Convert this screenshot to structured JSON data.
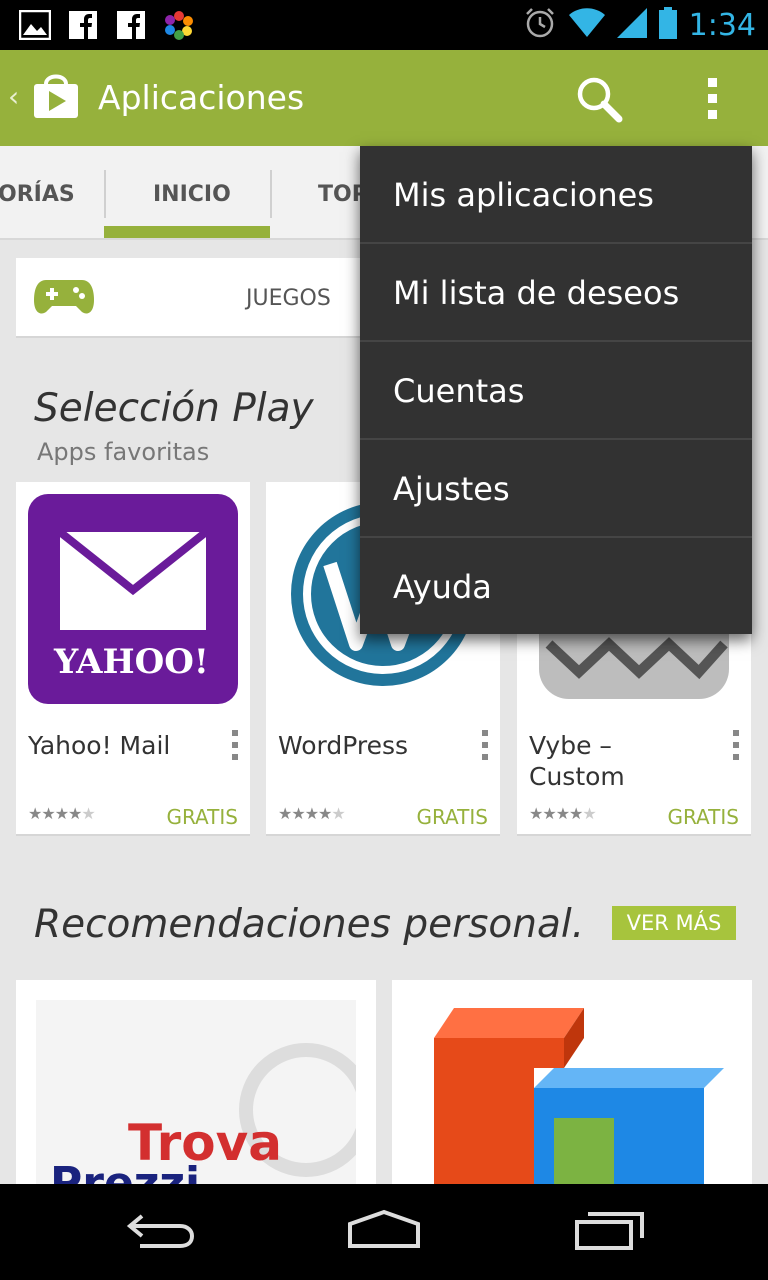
{
  "status_bar": {
    "time": "1:34",
    "accent": "#33b5e5"
  },
  "action_bar": {
    "title": "Aplicaciones",
    "color": "#96b13c"
  },
  "tabs": [
    {
      "label": "ORÍAS"
    },
    {
      "label": "INICIO"
    },
    {
      "label": "TOP"
    }
  ],
  "games_card": {
    "label": "JUEGOS"
  },
  "featured": {
    "title": "Selección Play",
    "subtitle": "Apps favoritas",
    "apps": [
      {
        "name": "Yahoo! Mail",
        "rating": 4,
        "price": "GRATIS",
        "icon_text": "YAHOO!"
      },
      {
        "name": "WordPress",
        "rating": 4,
        "price": "GRATIS"
      },
      {
        "name": "Vybe – Custom",
        "rating": 4,
        "price": "GRATIS"
      }
    ]
  },
  "recommendations": {
    "title": "Recomendaciones personal.",
    "more_label": "VER MÁS",
    "logo_text": "Trova",
    "logo_text_2": "Prezzi"
  },
  "menu": {
    "items": [
      {
        "label": "Mis aplicaciones"
      },
      {
        "label": "Mi lista de deseos"
      },
      {
        "label": "Cuentas"
      },
      {
        "label": "Ajustes"
      },
      {
        "label": "Ayuda"
      }
    ]
  },
  "colors": {
    "brand_green": "#96b13c",
    "menu_bg": "#323232",
    "yahoo_purple": "#6a1b9a",
    "wordpress_blue": "#21759b"
  }
}
